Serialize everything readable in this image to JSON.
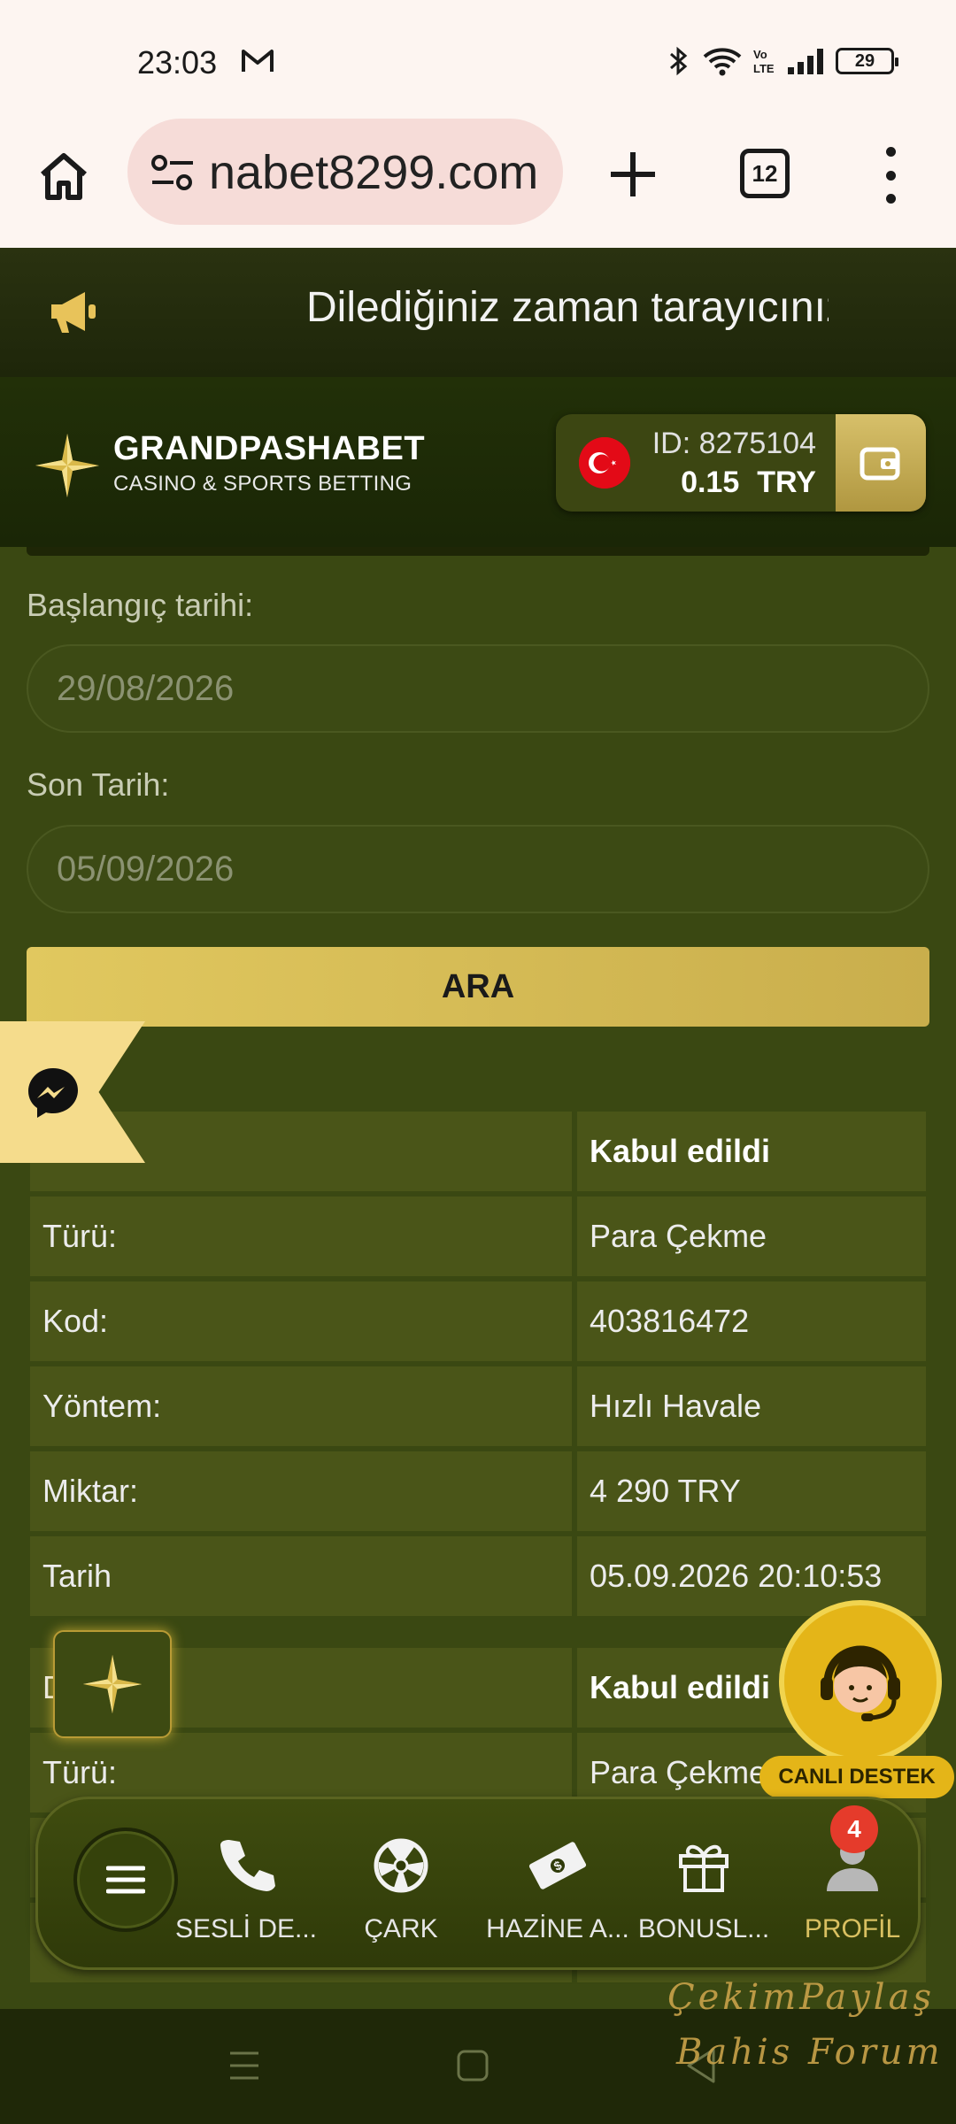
{
  "status_bar": {
    "time": "23:03",
    "battery": "29"
  },
  "browser": {
    "url": "nabet8299.com",
    "tab_count": "12"
  },
  "announcement": {
    "text": "Dilediğiniz zaman tarayıcınız"
  },
  "header": {
    "brand_name": "GRANDPASHABET",
    "brand_tagline": "CASINO & SPORTS BETTING",
    "account_id": "ID: 8275104",
    "balance_amount": "0.15",
    "balance_currency": "TRY"
  },
  "filters": {
    "start_label": "Başlangıç tarihi:",
    "start_value": "29/08/2026",
    "end_label": "Son Tarih:",
    "end_value": "05/09/2026",
    "search_label": "ARA"
  },
  "transactions": [
    {
      "rows": [
        {
          "label": ":",
          "value": "Kabul edildi"
        },
        {
          "label": "Türü:",
          "value": "Para Çekme"
        },
        {
          "label": "Kod:",
          "value": "403816472"
        },
        {
          "label": "Yöntem:",
          "value": "Hızlı Havale"
        },
        {
          "label": "Miktar:",
          "value": "4 290 TRY"
        },
        {
          "label": "Tarih",
          "value": "05.09.2026 20:10:53"
        }
      ]
    },
    {
      "rows": [
        {
          "label": "D",
          "value": "Kabul edildi"
        },
        {
          "label": "Türü:",
          "value": "Para Çekme"
        }
      ]
    }
  ],
  "support": {
    "label": "CANLI DESTEK"
  },
  "bottom_nav": {
    "items": [
      {
        "label": "SESLİ DE...",
        "icon": "phone-icon"
      },
      {
        "label": "ÇARK",
        "icon": "wheel-icon"
      },
      {
        "label": "HAZİNE A...",
        "icon": "money-icon"
      },
      {
        "label": "BONUSL...",
        "icon": "gift-icon"
      },
      {
        "label": "PROFİL",
        "icon": "profile-icon"
      }
    ],
    "profile_badge": "4"
  },
  "watermark": {
    "line1": "ÇekimPaylaş",
    "line2": "Bahis Forum"
  },
  "colors": {
    "gold": "#d9c061",
    "background": "#3a4812",
    "badge": "#e53b2b"
  }
}
